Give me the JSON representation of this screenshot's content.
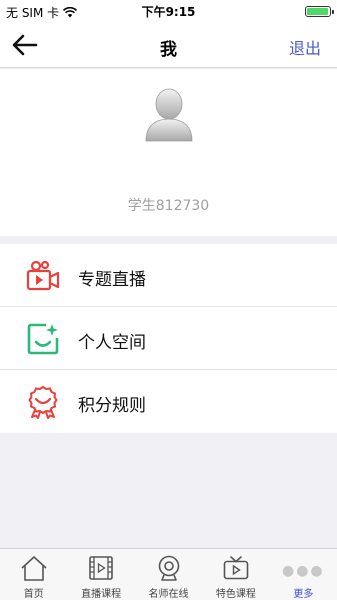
{
  "status_bar": {
    "carrier": "无 SIM 卡",
    "time": "下午9:15",
    "battery_level": 0.95
  },
  "nav": {
    "title": "我",
    "logout_label": "退出"
  },
  "profile": {
    "username": "学生812730"
  },
  "menu": {
    "items": [
      {
        "label": "专题直播",
        "icon": "camera-live-icon",
        "color": "#e8413c"
      },
      {
        "label": "个人空间",
        "icon": "personal-space-icon",
        "color": "#2cb878"
      },
      {
        "label": "积分规则",
        "icon": "award-ribbon-icon",
        "color": "#e8413c"
      }
    ]
  },
  "tab_bar": {
    "items": [
      {
        "label": "首页",
        "icon": "home-icon"
      },
      {
        "label": "直播课程",
        "icon": "film-play-icon"
      },
      {
        "label": "名师在线",
        "icon": "webcam-icon"
      },
      {
        "label": "特色课程",
        "icon": "tv-play-icon"
      },
      {
        "label": "更多",
        "icon": "more-dots-icon",
        "active": true
      }
    ],
    "active_color": "#3a4ee0"
  }
}
